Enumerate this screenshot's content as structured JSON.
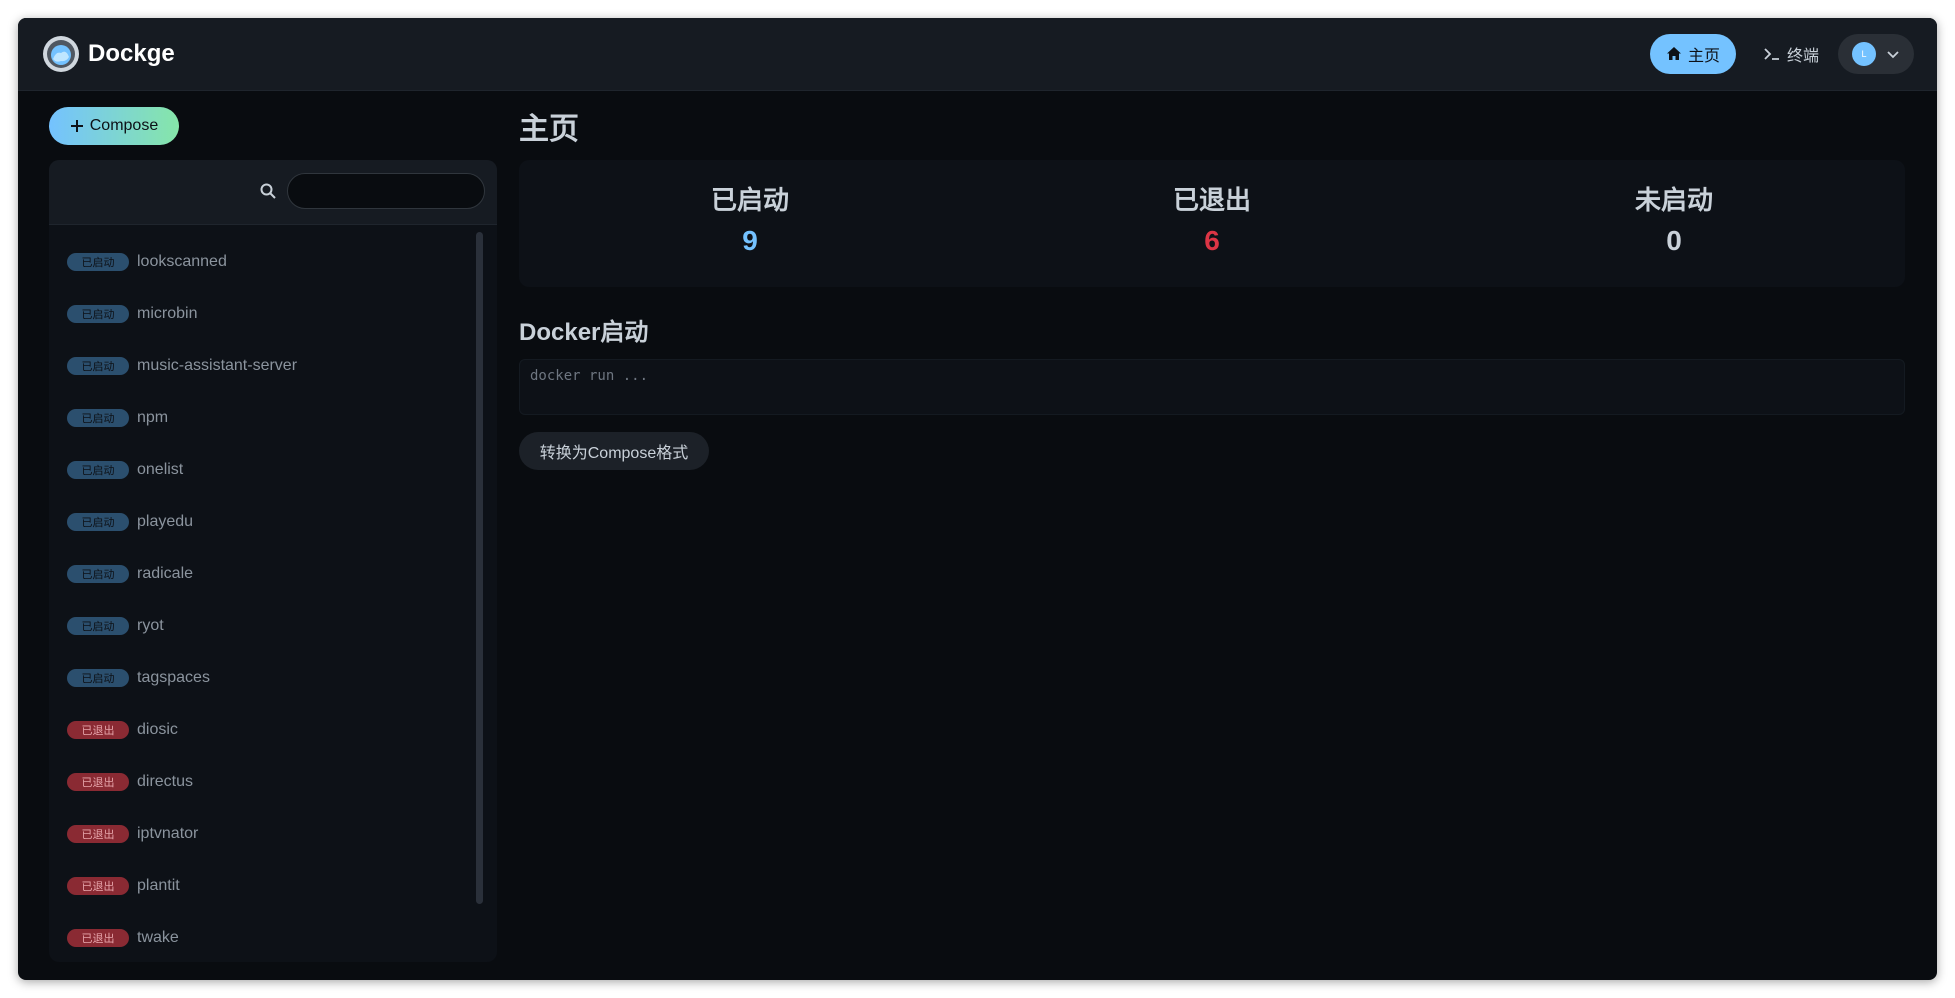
{
  "header": {
    "app_title": "Dockge",
    "nav_home": "主页",
    "nav_terminal": "终端",
    "avatar_letter": "L"
  },
  "sidebar": {
    "compose_label": "Compose",
    "search": {
      "value": "",
      "placeholder": ""
    },
    "stacks": [
      {
        "status": "已启动",
        "state": "active",
        "name": "lookscanned"
      },
      {
        "status": "已启动",
        "state": "active",
        "name": "microbin"
      },
      {
        "status": "已启动",
        "state": "active",
        "name": "music-assistant-server"
      },
      {
        "status": "已启动",
        "state": "active",
        "name": "npm"
      },
      {
        "status": "已启动",
        "state": "active",
        "name": "onelist"
      },
      {
        "status": "已启动",
        "state": "active",
        "name": "playedu"
      },
      {
        "status": "已启动",
        "state": "active",
        "name": "radicale"
      },
      {
        "status": "已启动",
        "state": "active",
        "name": "ryot"
      },
      {
        "status": "已启动",
        "state": "active",
        "name": "tagspaces"
      },
      {
        "status": "已退出",
        "state": "exited",
        "name": "diosic"
      },
      {
        "status": "已退出",
        "state": "exited",
        "name": "directus"
      },
      {
        "status": "已退出",
        "state": "exited",
        "name": "iptvnator"
      },
      {
        "status": "已退出",
        "state": "exited",
        "name": "plantit"
      },
      {
        "status": "已退出",
        "state": "exited",
        "name": "twake"
      }
    ]
  },
  "main": {
    "page_title": "主页",
    "stats": [
      {
        "label": "已启动",
        "value": "9",
        "color": "#74c2ff"
      },
      {
        "label": "已退出",
        "value": "6",
        "color": "#dc3545"
      },
      {
        "label": "未启动",
        "value": "0",
        "color": "#c9d1d9"
      }
    ],
    "docker_section_title": "Docker启动",
    "docker_input": {
      "value": "",
      "placeholder": "docker run ..."
    },
    "convert_button": "转换为Compose格式"
  },
  "colors": {
    "accent": "#74c2ff",
    "compose_gradient_end": "#86e6a9",
    "exited_red": "#dc3545",
    "background": "#090c10",
    "panel": "#0d1117"
  },
  "icons": {
    "logo": "dockge-logo-icon",
    "home": "home-icon",
    "terminal": "terminal-icon",
    "chevron": "chevron-down-icon",
    "plus": "plus-icon",
    "search": "search-icon"
  }
}
